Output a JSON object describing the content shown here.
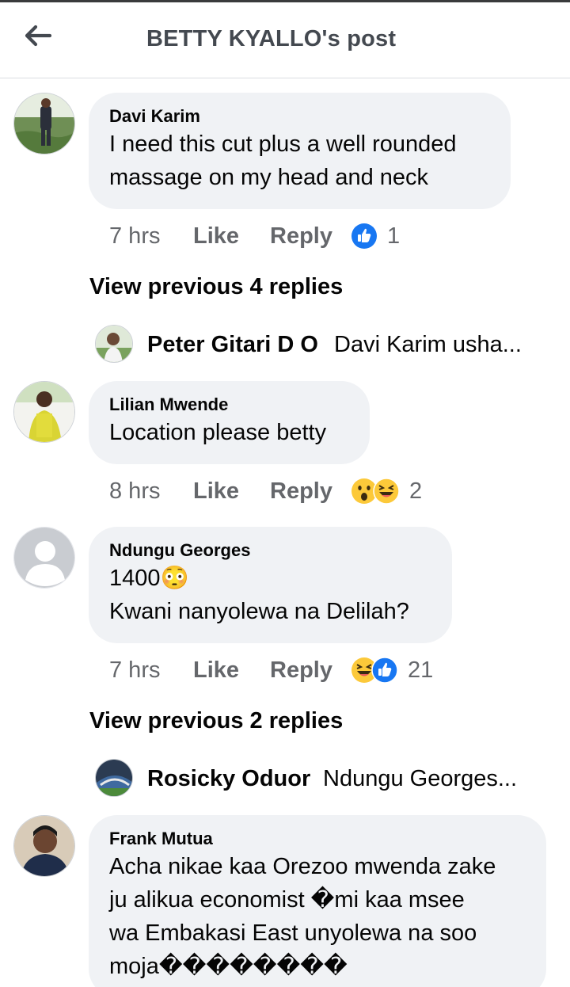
{
  "header": {
    "title": "BETTY KYALLO's post"
  },
  "comments": [
    {
      "author": "Davi Karim",
      "text": "I need this cut plus a well rounded\nmassage on my head and neck",
      "time": "7 hrs",
      "like": "Like",
      "reply": "Reply",
      "reactions": [
        "like"
      ],
      "reaction_count": "1"
    },
    {
      "author": "Lilian Mwende",
      "text": "Location please betty",
      "time": "8 hrs",
      "like": "Like",
      "reply": "Reply",
      "reactions": [
        "wow",
        "haha"
      ],
      "reaction_count": "2"
    },
    {
      "author": "Ndungu Georges",
      "text": "1400😳\nKwani nanyolewa na Delilah?",
      "time": "7 hrs",
      "like": "Like",
      "reply": "Reply",
      "reactions": [
        "haha",
        "like"
      ],
      "reaction_count": "21"
    },
    {
      "author": "Frank Mutua",
      "text": "Acha nikae kaa Orezoo mwenda zake\nju alikua economist �mi kaa msee\nwa Embakasi East unyolewa na soo\nmoja��������"
    }
  ],
  "view_previous": [
    "View previous 4 replies",
    "View previous 2 replies"
  ],
  "replies": [
    {
      "name": "Peter Gitari D O",
      "text": "Davi Karim usha..."
    },
    {
      "name": "Rosicky Oduor",
      "text": "Ndungu Georges..."
    }
  ],
  "colors": {
    "bubble": "#f0f2f5",
    "like_blue": "#1877f2",
    "meta_gray": "#65676b",
    "emoji_yellow": "#fcc93a"
  },
  "icons": {
    "back": "arrow-left-icon",
    "like": "like-thumb-icon",
    "wow": "wow-emoji-icon",
    "haha": "haha-emoji-icon"
  }
}
